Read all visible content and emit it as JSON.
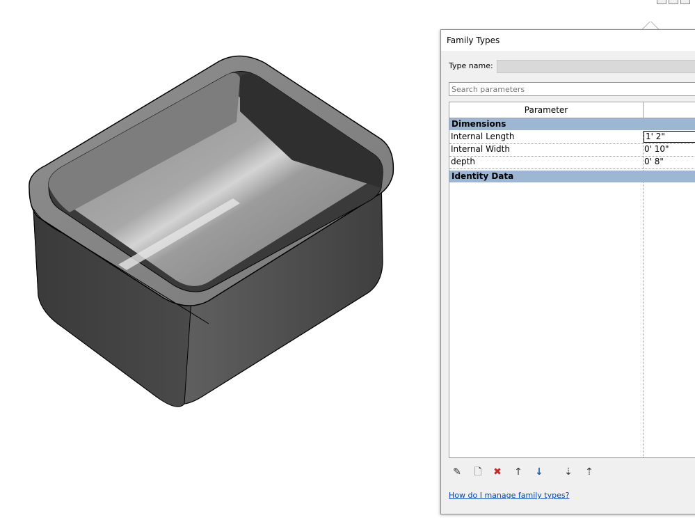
{
  "dialog": {
    "title": "Family Types",
    "type_name_label": "Type name:",
    "type_name_value": "",
    "search_placeholder": "Search parameters",
    "columns": {
      "parameter": "Parameter"
    },
    "groups": [
      {
        "name": "Dimensions",
        "rows": [
          {
            "name": "Internal Length",
            "value": "1'  2\""
          },
          {
            "name": "Internal Width",
            "value": "0'  10\""
          },
          {
            "name": "depth",
            "value": "0'  8\""
          }
        ]
      },
      {
        "name": "Identity Data",
        "rows": []
      }
    ],
    "toolbar_icons": [
      "pencil-icon",
      "new-parameter-icon",
      "delete-parameter-icon",
      "move-up-icon",
      "move-down-icon",
      "sort-ascending-icon",
      "sort-descending-icon"
    ],
    "help_link": "How do I manage family types?"
  },
  "colors": {
    "group_header": "#9cb6d3",
    "link": "#0645ad"
  }
}
